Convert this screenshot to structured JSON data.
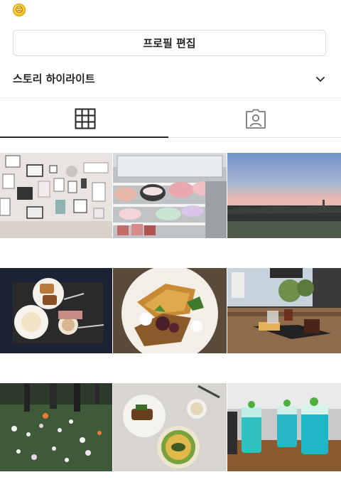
{
  "profile": {
    "bio_emoji": "😔",
    "edit_profile_label": "프로필 편집",
    "story_highlights_label": "스토리 하이라이트"
  },
  "tabs": [
    {
      "name": "grid",
      "icon": "grid-icon",
      "active": true
    },
    {
      "name": "tagged",
      "icon": "tagged-person-icon",
      "active": false
    }
  ],
  "posts": [
    {
      "icon": "photo-gallery-wall"
    },
    {
      "icon": "photo-macaron-display"
    },
    {
      "icon": "photo-sunset-sky"
    },
    {
      "icon": "photo-pastries-coffee"
    },
    {
      "icon": "photo-french-toast"
    },
    {
      "icon": "photo-cafe-dessert"
    },
    {
      "icon": "photo-wildflowers"
    },
    {
      "icon": "photo-dinner-plates"
    },
    {
      "icon": "photo-blue-drinks"
    }
  ],
  "colors": {
    "text": "#262626",
    "border": "#dbdbdb",
    "divider": "#efefef"
  }
}
